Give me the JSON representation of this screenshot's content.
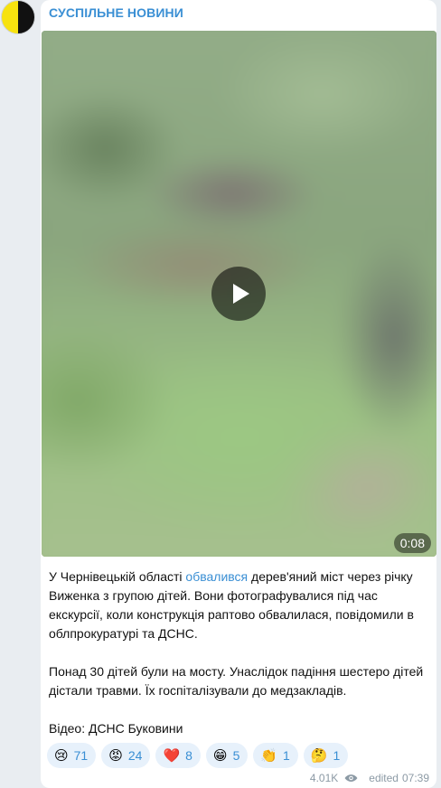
{
  "channel": {
    "name": "СУСПІЛЬНЕ НОВИНИ"
  },
  "video": {
    "duration": "0:08",
    "icon": "play-icon"
  },
  "post": {
    "p1_before": "У Чернівецькій області ",
    "p1_link": "обвалився",
    "p1_after": " дерев'яний міст через річку Виженка з групою дітей. Вони фотографувалися під час екскурсії, коли конструкція раптово обвалилася, повідомили в облпрокуратурі та ДСНС.",
    "p2": "Понад 30 дітей були на мосту. Унаслідок падіння шестеро дітей дістали травми. Їх госпіталізували до медзакладів.",
    "p3": "Відео: ДСНС Буковини"
  },
  "reactions": [
    {
      "emoji": "😢",
      "count": "71",
      "icon": "crying-face-icon"
    },
    {
      "emoji": "😡",
      "count": "24",
      "icon": "angry-face-icon"
    },
    {
      "emoji": "❤️",
      "count": "8",
      "icon": "heart-icon"
    },
    {
      "emoji": "😁",
      "count": "5",
      "icon": "grinning-face-icon"
    },
    {
      "emoji": "👏",
      "count": "1",
      "icon": "clapping-hands-icon"
    },
    {
      "emoji": "🤔",
      "count": "1",
      "icon": "thinking-face-icon"
    }
  ],
  "meta": {
    "views": "4.01K",
    "edited_label": "edited",
    "time": "07:39"
  },
  "colors": {
    "accent": "#3a8fd4",
    "reaction_bg": "#e7f1fb",
    "page_bg": "#e9edf1"
  }
}
